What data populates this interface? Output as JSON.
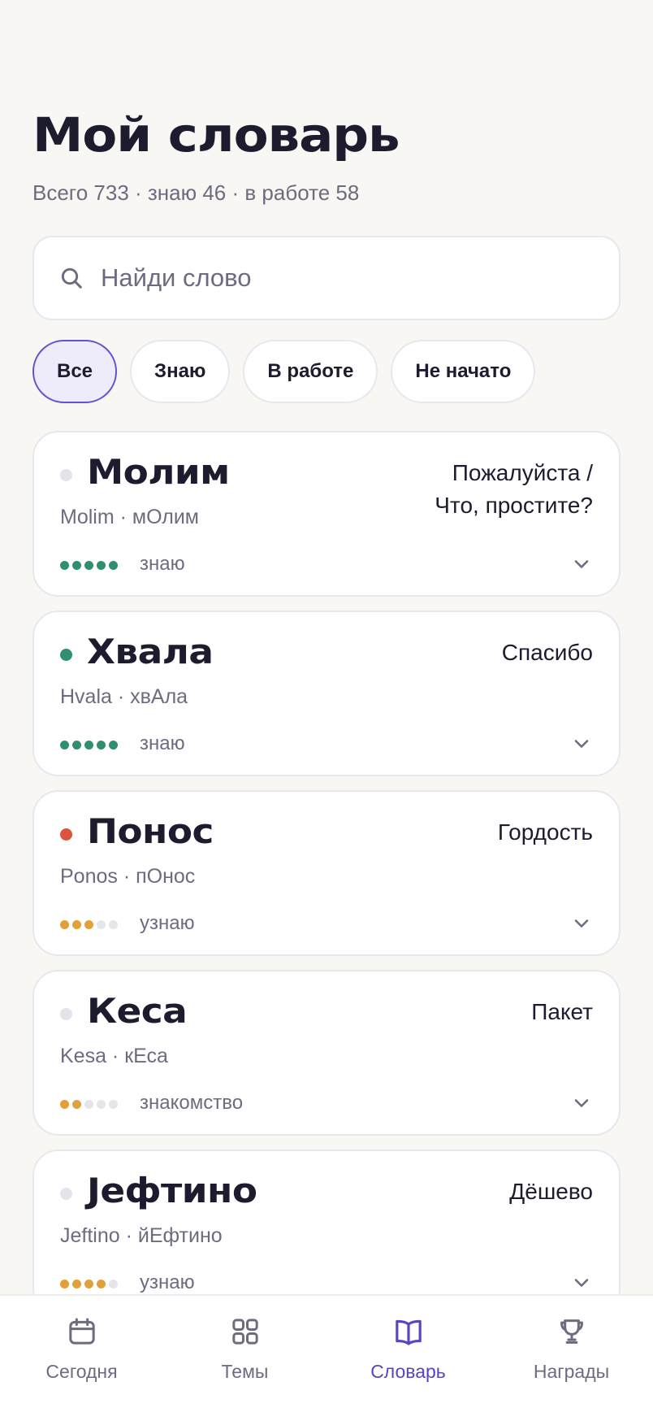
{
  "header": {
    "title": "Мой словарь",
    "stats": "Всего 733 · знаю 46 · в работе 58"
  },
  "search": {
    "placeholder": "Найди слово",
    "value": ""
  },
  "filters": [
    {
      "label": "Все",
      "active": true
    },
    {
      "label": "Знаю",
      "active": false
    },
    {
      "label": "В работе",
      "active": false
    },
    {
      "label": "Не начато",
      "active": false
    }
  ],
  "words": [
    {
      "word": "Молим",
      "transliteration": "Molim · мОлим",
      "translation": "Пожалуйста /\nЧто, простите?",
      "status_color": "#e4e3ec",
      "progress": 5,
      "progress_color": "#2f8f6f",
      "level": "знаю"
    },
    {
      "word": "Хвала",
      "transliteration": "Hvala · хвАла",
      "translation": "Спасибо",
      "status_color": "#2f8f6f",
      "progress": 5,
      "progress_color": "#2f8f6f",
      "level": "знаю"
    },
    {
      "word": "Понос",
      "transliteration": "Ponos · пОнос",
      "translation": "Гордость",
      "status_color": "#d9553f",
      "progress": 3,
      "progress_color": "#e2a03a",
      "level": "узнаю"
    },
    {
      "word": "Кеса",
      "transliteration": "Kesa · кЕса",
      "translation": "Пакет",
      "status_color": "#e4e3ec",
      "progress": 2,
      "progress_color": "#e2a03a",
      "level": "знакомство"
    },
    {
      "word": "Јефтино",
      "transliteration": "Jeftino · йЕфтино",
      "translation": "Дёшево",
      "status_color": "#e4e3ec",
      "progress": 4,
      "progress_color": "#e2a03a",
      "level": "узнаю"
    }
  ],
  "tabbar": [
    {
      "label": "Сегодня",
      "icon": "calendar-icon",
      "active": false
    },
    {
      "label": "Темы",
      "icon": "grid-icon",
      "active": false
    },
    {
      "label": "Словарь",
      "icon": "book-icon",
      "active": true
    },
    {
      "label": "Награды",
      "icon": "trophy-icon",
      "active": false
    }
  ],
  "colors": {
    "accent": "#5b44c2",
    "known": "#2f8f6f",
    "learning": "#e2a03a",
    "error": "#d9553f"
  }
}
